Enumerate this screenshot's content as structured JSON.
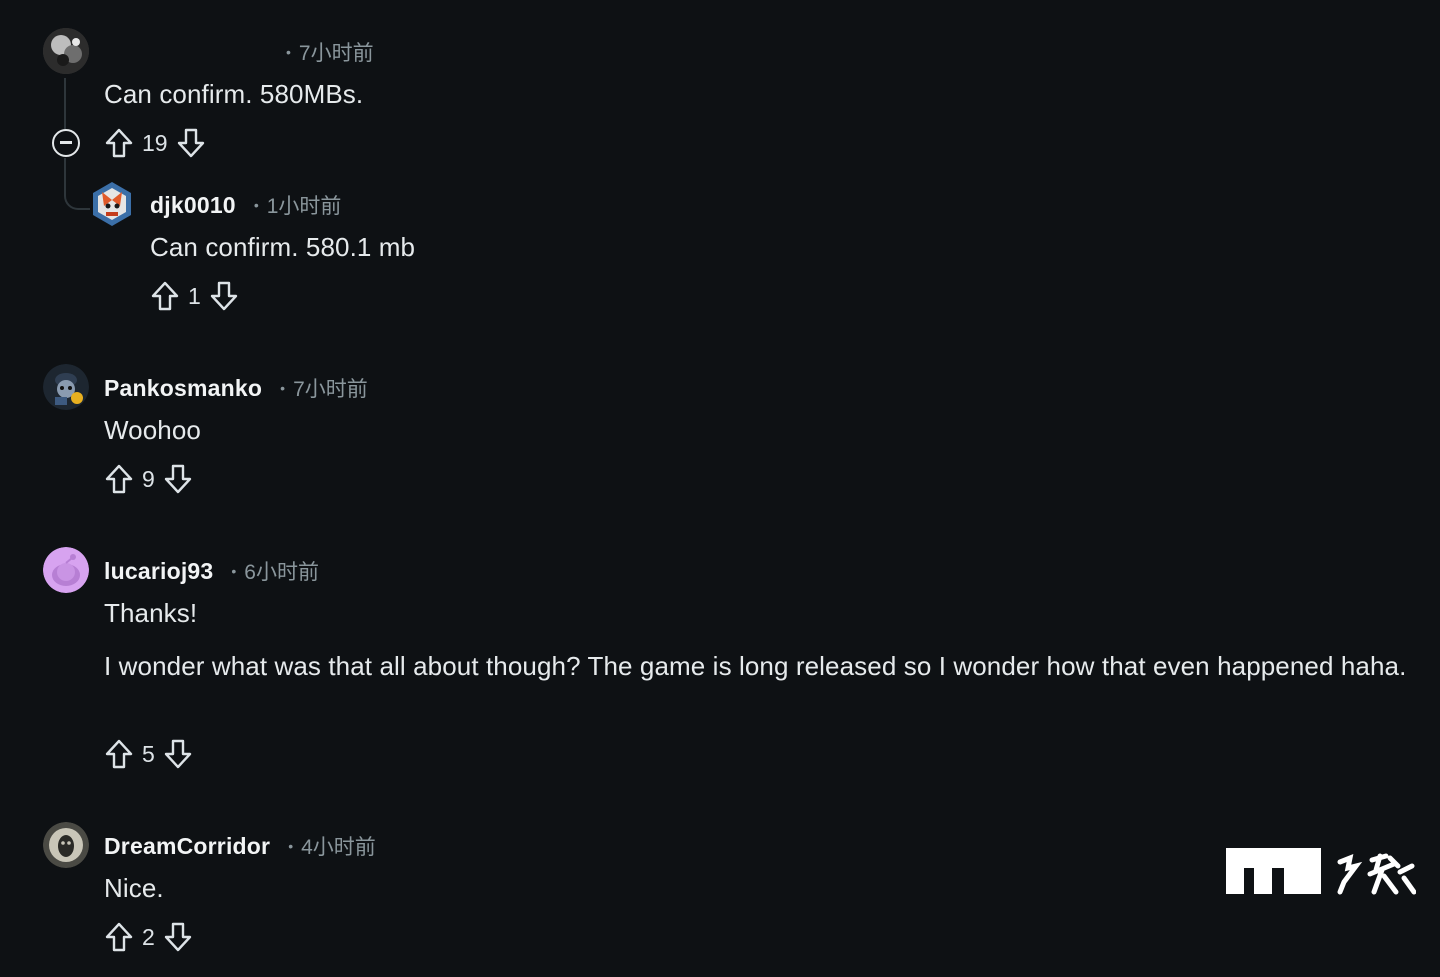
{
  "comments": [
    {
      "username": "",
      "time": "7小时前",
      "body": [
        "Can confirm. 580MBs."
      ],
      "votes": "19"
    },
    {
      "username": "djk0010",
      "time": "1小时前",
      "body": [
        "Can confirm. 580.1 mb"
      ],
      "votes": "1"
    },
    {
      "username": "Pankosmanko",
      "time": "7小时前",
      "body": [
        "Woohoo"
      ],
      "votes": "9"
    },
    {
      "username": "lucarioj93",
      "time": "6小时前",
      "body": [
        "Thanks!",
        "I wonder what was that all about though? The game is long released so I wonder how that even happened haha."
      ],
      "votes": "5"
    },
    {
      "username": "DreamCorridor",
      "time": "4小时前",
      "body": [
        "Nice."
      ],
      "votes": "2"
    }
  ],
  "separator": "•",
  "icons": {
    "upvote": "upvote-arrow-icon",
    "downvote": "downvote-arrow-icon",
    "collapse": "collapse-thread-icon"
  },
  "watermark": {
    "logo": "IT之家"
  },
  "colors": {
    "background": "#0e1114",
    "text": "#e6eaec",
    "muted": "#8a969c",
    "avatar_lucario": "#d7a3f0"
  }
}
